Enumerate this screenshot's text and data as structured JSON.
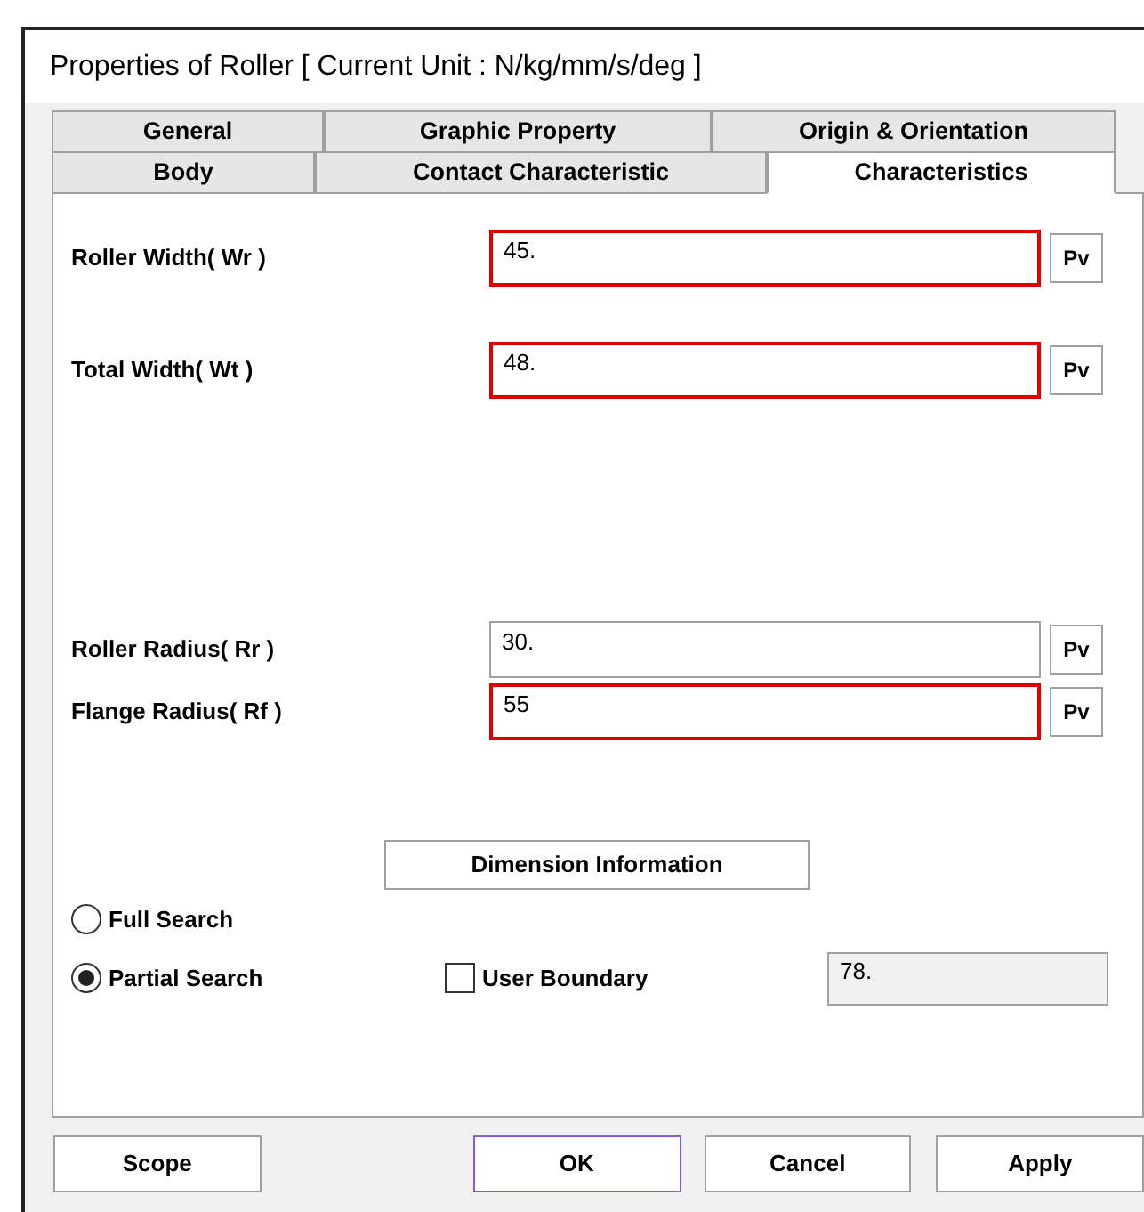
{
  "window": {
    "title": "Properties of Roller [ Current Unit : N/kg/mm/s/deg ]"
  },
  "tab_rows": [
    [
      {
        "label": "General",
        "selected": false
      },
      {
        "label": "Graphic Property",
        "selected": false
      },
      {
        "label": "Origin & Orientation",
        "selected": false
      }
    ],
    [
      {
        "label": "Body",
        "selected": false
      },
      {
        "label": "Contact Characteristic",
        "selected": false
      },
      {
        "label": "Characteristics",
        "selected": true
      }
    ]
  ],
  "fields": [
    {
      "label": "Roller Width( Wr )",
      "value": "45.",
      "highlighted": true,
      "button": "Pv"
    },
    {
      "label": "Total Width( Wt )",
      "value": "48.",
      "highlighted": true,
      "button": "Pv"
    },
    {
      "label": "Roller Radius( Rr )",
      "value": "30.",
      "highlighted": false,
      "button": "Pv"
    },
    {
      "label": "Flange Radius( Rf )",
      "value": "55",
      "highlighted": true,
      "button": "Pv"
    }
  ],
  "dimension_button": {
    "label": "Dimension Information"
  },
  "search_options": [
    {
      "label": "Full Search",
      "selected": false
    },
    {
      "label": "Partial Search",
      "selected": true
    }
  ],
  "user_boundary": {
    "label": "User Boundary",
    "checked": false,
    "value": "78.",
    "disabled": true
  },
  "buttons": [
    {
      "label": "Scope",
      "focused": false
    },
    {
      "label": "OK",
      "focused": true
    },
    {
      "label": "Cancel",
      "focused": false
    },
    {
      "label": "Apply",
      "focused": false
    }
  ]
}
